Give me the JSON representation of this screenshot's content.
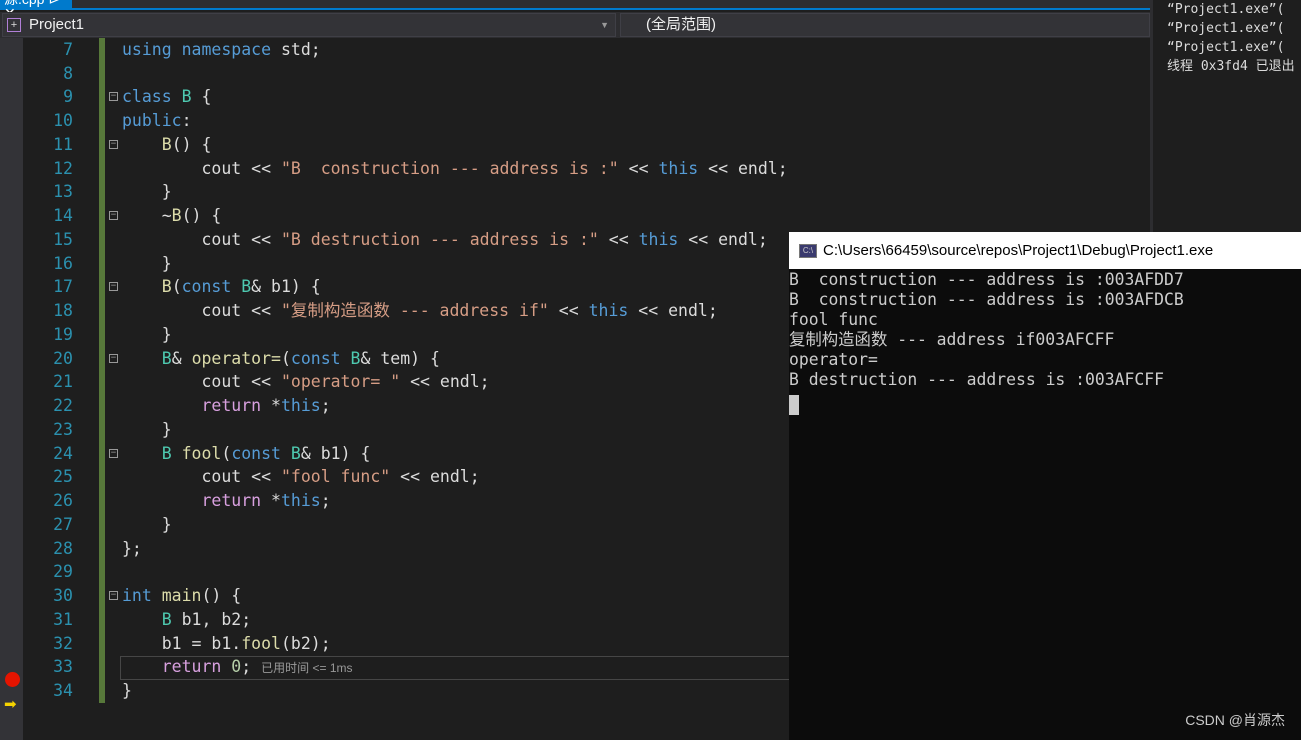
{
  "tab": {
    "label": "源.cpp  ⊳ ✕"
  },
  "nav": {
    "project": "Project1",
    "scope": "(全局范围)"
  },
  "editor": {
    "lines": [
      {
        "n": "7",
        "t": [
          [
            "using namespace ",
            "kw"
          ],
          [
            "std;",
            "plain"
          ]
        ]
      },
      {
        "n": "8",
        "t": []
      },
      {
        "n": "9",
        "fold": true,
        "t": [
          [
            "class ",
            "kw"
          ],
          [
            "B",
            "cls"
          ],
          [
            " {",
            "plain"
          ]
        ]
      },
      {
        "n": "10",
        "t": [
          [
            "public",
            "kw"
          ],
          [
            ":",
            "plain"
          ]
        ]
      },
      {
        "n": "11",
        "fold": true,
        "t": [
          [
            "    ",
            "plain"
          ],
          [
            "B",
            "fn"
          ],
          [
            "() {",
            "plain"
          ]
        ]
      },
      {
        "n": "12",
        "t": [
          [
            "        cout << ",
            "plain"
          ],
          [
            "\"B  construction --- address is :\"",
            "str"
          ],
          [
            " << ",
            "plain"
          ],
          [
            "this",
            "kw"
          ],
          [
            " << endl;",
            "plain"
          ]
        ]
      },
      {
        "n": "13",
        "t": [
          [
            "    }",
            "plain"
          ]
        ]
      },
      {
        "n": "14",
        "fold": true,
        "t": [
          [
            "    ~",
            "plain"
          ],
          [
            "B",
            "fn"
          ],
          [
            "() {",
            "plain"
          ]
        ]
      },
      {
        "n": "15",
        "t": [
          [
            "        cout << ",
            "plain"
          ],
          [
            "\"B destruction --- address is :\"",
            "str"
          ],
          [
            " << ",
            "plain"
          ],
          [
            "this",
            "kw"
          ],
          [
            " << endl;",
            "plain"
          ]
        ]
      },
      {
        "n": "16",
        "t": [
          [
            "    }",
            "plain"
          ]
        ]
      },
      {
        "n": "17",
        "fold": true,
        "t": [
          [
            "    ",
            "plain"
          ],
          [
            "B",
            "fn"
          ],
          [
            "(",
            "plain"
          ],
          [
            "const ",
            "kw"
          ],
          [
            "B",
            "cls"
          ],
          [
            "& b1) {",
            "plain"
          ]
        ]
      },
      {
        "n": "18",
        "t": [
          [
            "        cout << ",
            "plain"
          ],
          [
            "\"复制构造函数 --- address if\"",
            "str"
          ],
          [
            " << ",
            "plain"
          ],
          [
            "this",
            "kw"
          ],
          [
            " << endl;",
            "plain"
          ]
        ]
      },
      {
        "n": "19",
        "t": [
          [
            "    }",
            "plain"
          ]
        ]
      },
      {
        "n": "20",
        "fold": true,
        "t": [
          [
            "    ",
            "plain"
          ],
          [
            "B",
            "cls"
          ],
          [
            "& ",
            "plain"
          ],
          [
            "operator=",
            "fn"
          ],
          [
            "(",
            "plain"
          ],
          [
            "const ",
            "kw"
          ],
          [
            "B",
            "cls"
          ],
          [
            "& tem) {",
            "plain"
          ]
        ]
      },
      {
        "n": "21",
        "t": [
          [
            "        cout << ",
            "plain"
          ],
          [
            "\"operator= \"",
            "str"
          ],
          [
            " << endl;",
            "plain"
          ]
        ]
      },
      {
        "n": "22",
        "t": [
          [
            "        ",
            "plain"
          ],
          [
            "return ",
            "ret"
          ],
          [
            "*",
            "plain"
          ],
          [
            "this",
            "kw"
          ],
          [
            ";",
            "plain"
          ]
        ]
      },
      {
        "n": "23",
        "t": [
          [
            "    }",
            "plain"
          ]
        ]
      },
      {
        "n": "24",
        "fold": true,
        "t": [
          [
            "    ",
            "plain"
          ],
          [
            "B ",
            "cls"
          ],
          [
            "fool",
            "fn"
          ],
          [
            "(",
            "plain"
          ],
          [
            "const ",
            "kw"
          ],
          [
            "B",
            "cls"
          ],
          [
            "& b1) {",
            "plain"
          ]
        ]
      },
      {
        "n": "25",
        "t": [
          [
            "        cout << ",
            "plain"
          ],
          [
            "\"fool func\"",
            "str"
          ],
          [
            " << endl;",
            "plain"
          ]
        ]
      },
      {
        "n": "26",
        "t": [
          [
            "        ",
            "plain"
          ],
          [
            "return ",
            "ret"
          ],
          [
            "*",
            "plain"
          ],
          [
            "this",
            "kw"
          ],
          [
            ";",
            "plain"
          ]
        ]
      },
      {
        "n": "27",
        "t": [
          [
            "    }",
            "plain"
          ]
        ]
      },
      {
        "n": "28",
        "t": [
          [
            "};",
            "plain"
          ]
        ]
      },
      {
        "n": "29",
        "t": []
      },
      {
        "n": "30",
        "fold": true,
        "t": [
          [
            "int ",
            "kw"
          ],
          [
            "main",
            "fn"
          ],
          [
            "() {",
            "plain"
          ]
        ]
      },
      {
        "n": "31",
        "t": [
          [
            "    ",
            "plain"
          ],
          [
            "B ",
            "cls"
          ],
          [
            "b1, b2;",
            "plain"
          ]
        ]
      },
      {
        "n": "32",
        "t": [
          [
            "    b1 = b1.",
            "plain"
          ],
          [
            "fool",
            "fn"
          ],
          [
            "(b2);",
            "plain"
          ]
        ]
      },
      {
        "n": "33",
        "t": [
          [
            "    ",
            "plain"
          ],
          [
            "return ",
            "ret"
          ],
          [
            "0",
            "num"
          ],
          [
            ";",
            "plain"
          ]
        ],
        "perf": "已用时间 <= 1ms"
      },
      {
        "n": "34",
        "t": [
          [
            "}",
            "plain"
          ]
        ]
      }
    ]
  },
  "output": [
    "“Project1.exe”(",
    "“Project1.exe”(",
    "“Project1.exe”(",
    "线程 0x3fd4 已退出"
  ],
  "console": {
    "title": "C:\\Users\\66459\\source\\repos\\Project1\\Debug\\Project1.exe",
    "lines": [
      "B  construction --- address is :003AFDD7",
      "B  construction --- address is :003AFDCB",
      "fool func",
      "复制构造函数 --- address if003AFCFF",
      "operator=",
      "B destruction --- address is :003AFCFF"
    ]
  },
  "watermark": "CSDN @肖源杰",
  "colors": {
    "accent": "#007acc",
    "breakpoint": "#e51400",
    "changebar": "#57783a"
  }
}
